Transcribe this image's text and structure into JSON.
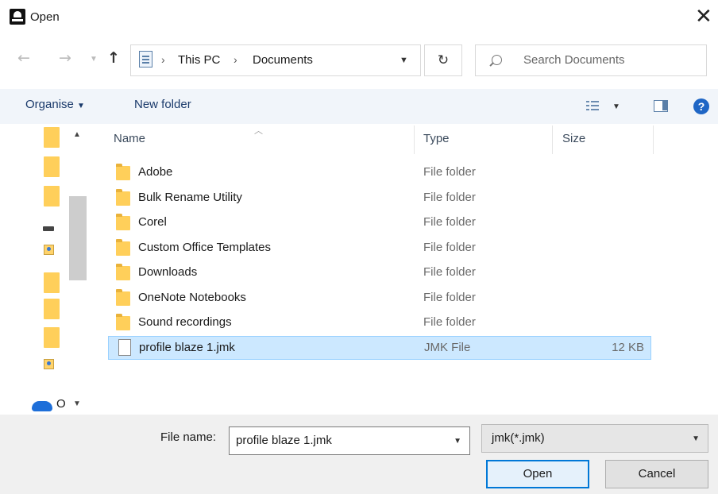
{
  "window": {
    "title": "Open",
    "close_glyph": "✕"
  },
  "nav": {
    "back_icon": "back-arrow-icon",
    "forward_icon": "forward-arrow-icon",
    "up_icon": "up-arrow-icon",
    "breadcrumb": [
      "This PC",
      "Documents"
    ],
    "search_placeholder": "Search Documents"
  },
  "toolbar": {
    "organise_label": "Organise",
    "new_folder_label": "New folder",
    "help_label": "?"
  },
  "nav_pane": {
    "cloud_label": "O"
  },
  "columns": {
    "name": "Name",
    "type": "Type",
    "size": "Size"
  },
  "files": [
    {
      "name": "Adobe",
      "type": "File folder",
      "size": "",
      "kind": "folder"
    },
    {
      "name": "Bulk Rename Utility",
      "type": "File folder",
      "size": "",
      "kind": "folder"
    },
    {
      "name": "Corel",
      "type": "File folder",
      "size": "",
      "kind": "folder"
    },
    {
      "name": "Custom Office Templates",
      "type": "File folder",
      "size": "",
      "kind": "folder"
    },
    {
      "name": "Downloads",
      "type": "File folder",
      "size": "",
      "kind": "folder"
    },
    {
      "name": "OneNote Notebooks",
      "type": "File folder",
      "size": "",
      "kind": "folder"
    },
    {
      "name": "Sound recordings",
      "type": "File folder",
      "size": "",
      "kind": "folder"
    },
    {
      "name": "profile blaze 1.jmk",
      "type": "JMK File",
      "size": "12 KB",
      "kind": "file",
      "selected": true
    }
  ],
  "footer": {
    "filename_label": "File name:",
    "filename_value": "profile blaze 1.jmk",
    "filetype_value": "jmk(*.jmk)",
    "open_label": "Open",
    "cancel_label": "Cancel"
  },
  "colors": {
    "accent": "#0078d7",
    "selection_bg": "#cce8ff",
    "toolbar_bg": "#f1f5fa",
    "folder": "#ffcf5a"
  }
}
